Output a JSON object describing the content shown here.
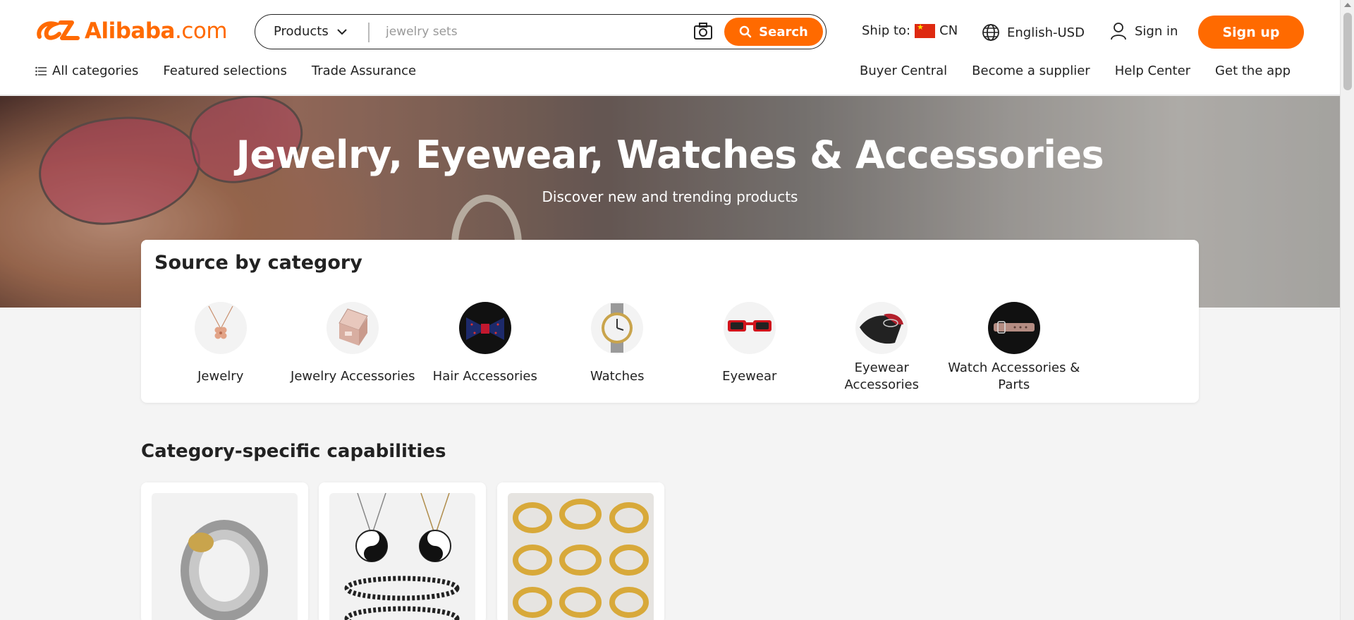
{
  "header": {
    "logo_text": "Alibaba",
    "logo_suffix": ".com",
    "search": {
      "type_label": "Products",
      "placeholder": "jewelry sets",
      "button_label": "Search"
    },
    "ship_to_label": "Ship to:",
    "ship_to_country": "CN",
    "language_currency": "English-USD",
    "sign_in": "Sign in",
    "sign_up": "Sign up"
  },
  "nav": {
    "left": [
      "All categories",
      "Featured selections",
      "Trade Assurance"
    ],
    "right": [
      "Buyer Central",
      "Become a supplier",
      "Help Center",
      "Get the app"
    ]
  },
  "banner": {
    "title": "Jewelry, Eyewear, Watches & Accessories",
    "subtitle": "Discover new and trending products"
  },
  "source_by_category": {
    "title": "Source by category",
    "categories": [
      {
        "label": "Jewelry"
      },
      {
        "label": "Jewelry Accessories"
      },
      {
        "label": "Hair Accessories"
      },
      {
        "label": "Watches"
      },
      {
        "label": "Eyewear"
      },
      {
        "label": "Eyewear Accessories"
      },
      {
        "label": "Watch Accessories & Parts"
      }
    ]
  },
  "capabilities": {
    "title": "Category-specific capabilities"
  },
  "colors": {
    "brand": "#ff6a00",
    "text": "#222222",
    "background": "#f4f4f4"
  }
}
